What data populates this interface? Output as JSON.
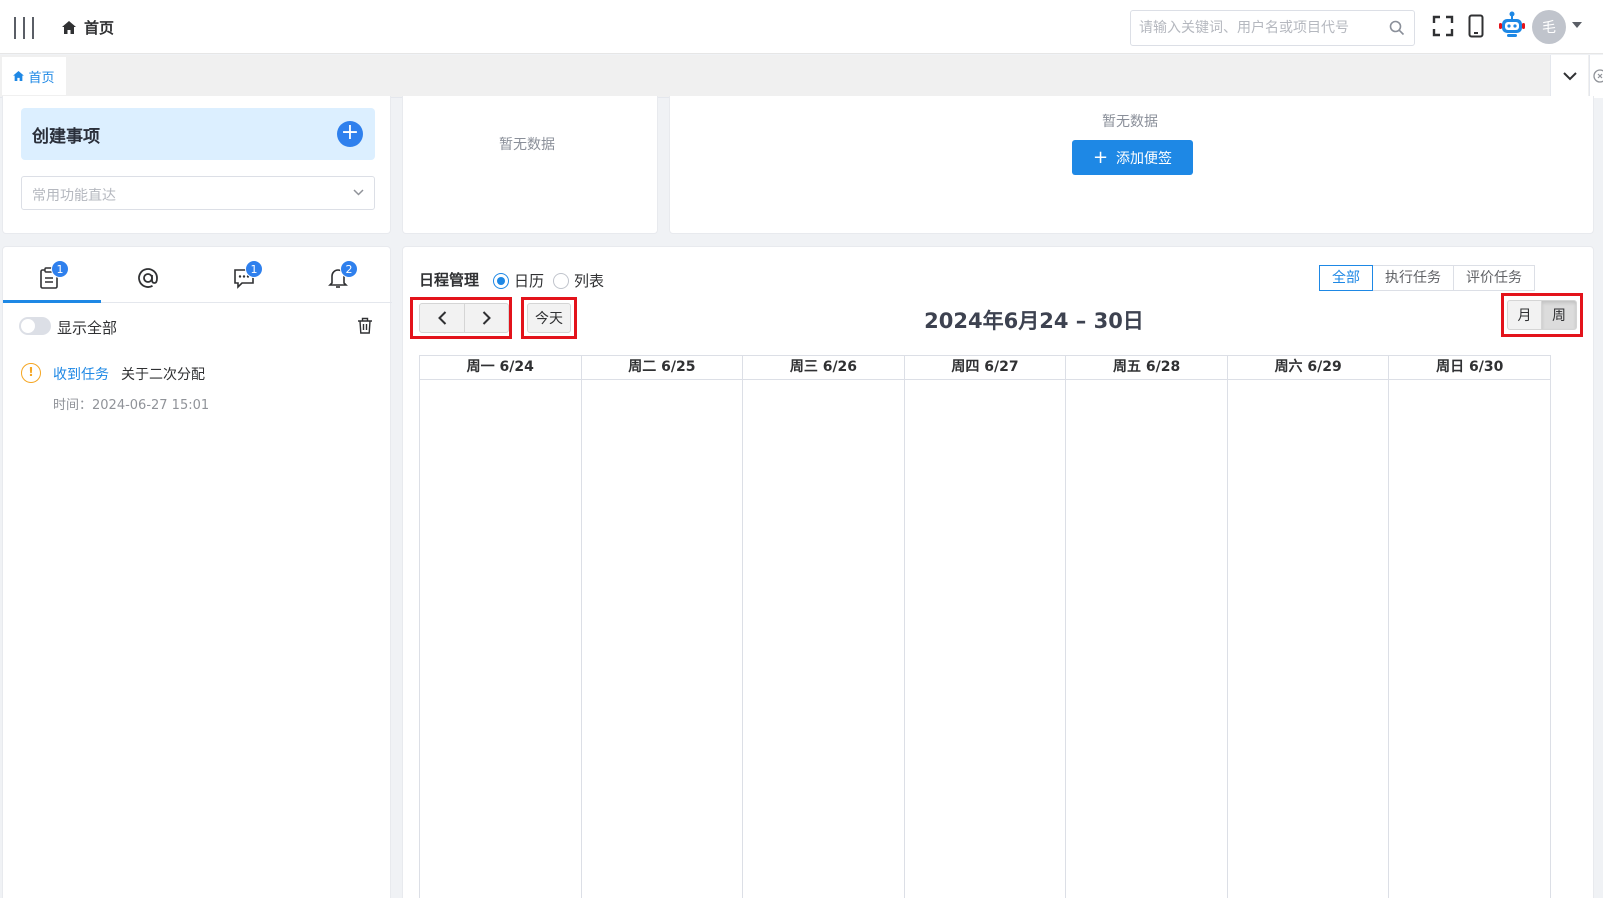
{
  "header": {
    "breadcrumb": "首页",
    "search_placeholder": "请输入关键词、用户名或项目代号",
    "avatar_text": "毛"
  },
  "tabs": [
    {
      "label": "首页",
      "active": true
    }
  ],
  "create": {
    "title": "创建事项",
    "plus_label": "+",
    "quick_placeholder": "常用功能直达"
  },
  "empty_card_1": {
    "text": "暂无数据"
  },
  "notes_card": {
    "empty_text": "暂无数据",
    "add_button": "添加便签",
    "add_icon": "+"
  },
  "messages": {
    "tabs": [
      {
        "icon": "todo-list-icon",
        "badge": "1"
      },
      {
        "icon": "at-icon",
        "badge": ""
      },
      {
        "icon": "comment-icon",
        "badge": "1"
      },
      {
        "icon": "bell-icon",
        "badge": "2"
      }
    ],
    "show_all_label": "显示全部",
    "notice": {
      "icon": "!",
      "type": "收到任务",
      "title": "关于二次分配",
      "time": "时间：2024-06-27 15:01"
    }
  },
  "schedule": {
    "title": "日程管理",
    "view_options": [
      {
        "label": "日历",
        "selected": true
      },
      {
        "label": "列表",
        "selected": false
      }
    ],
    "filters": [
      {
        "label": "全部",
        "active": true
      },
      {
        "label": "执行任务",
        "active": false
      },
      {
        "label": "评价任务",
        "active": false
      }
    ],
    "today_label": "今天",
    "range_title": "2024年6月24 – 30日",
    "month_label": "月",
    "week_label": "周",
    "days": [
      "周一 6/24",
      "周二 6/25",
      "周三 6/26",
      "周四 6/27",
      "周五 6/28",
      "周六 6/29",
      "周日 6/30"
    ]
  },
  "colors": {
    "accent": "#1e88e5",
    "highlight_border": "#e3131b",
    "warning": "#f5a623"
  }
}
